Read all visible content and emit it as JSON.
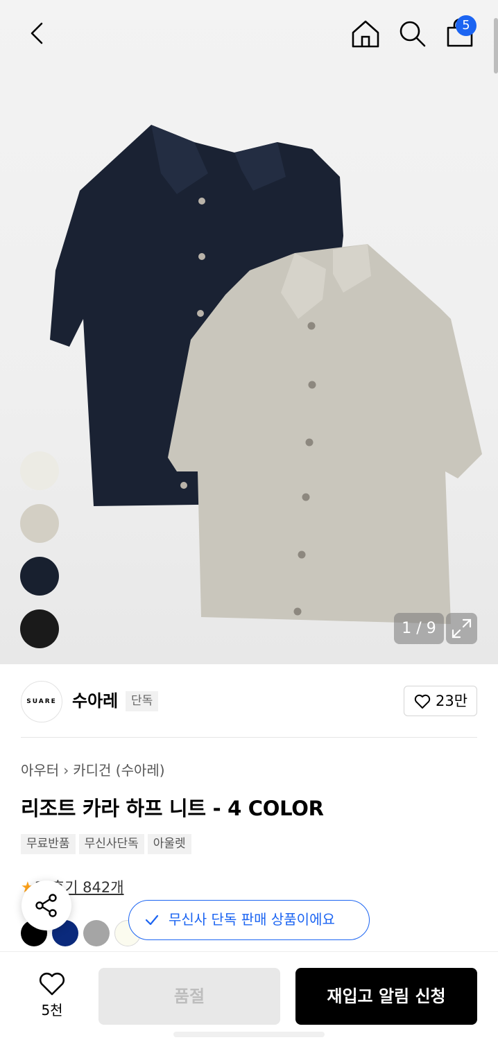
{
  "header": {
    "cart_count": "5"
  },
  "gallery": {
    "counter": "1 / 9",
    "swatches": [
      {
        "name": "ivory",
        "color": "#ecebe4"
      },
      {
        "name": "beige",
        "color": "#d3cfc4"
      },
      {
        "name": "navy",
        "color": "#18202f"
      },
      {
        "name": "black",
        "color": "#1a1a1a"
      }
    ],
    "shirt_colors": {
      "navy": "#1a2233",
      "beige": "#c9c6bc"
    }
  },
  "brand": {
    "logo_text": "SUARE",
    "name": "수아레",
    "tag": "단독",
    "likes": "23만"
  },
  "product": {
    "breadcrumb": [
      "아우터",
      "카디건 (수아레)"
    ],
    "title": "리조트 카라 하프 니트 - 4 COLOR",
    "chips": [
      "무료반품",
      "무신사단독",
      "아울렛"
    ],
    "rating_star": "★",
    "rating_value": "3",
    "reviews": "후기 842개",
    "colors": [
      "#000000",
      "#0b2a7c",
      "#a5a5a5",
      "#fbfbef"
    ]
  },
  "toast": {
    "text": "무신사 단독 판매 상품이에요"
  },
  "bottom": {
    "wish_count": "5천",
    "soldout_label": "품절",
    "restock_label": "재입고 알림 신청"
  },
  "colors": {
    "accent": "#1b64f2",
    "star": "#ffa31a"
  }
}
